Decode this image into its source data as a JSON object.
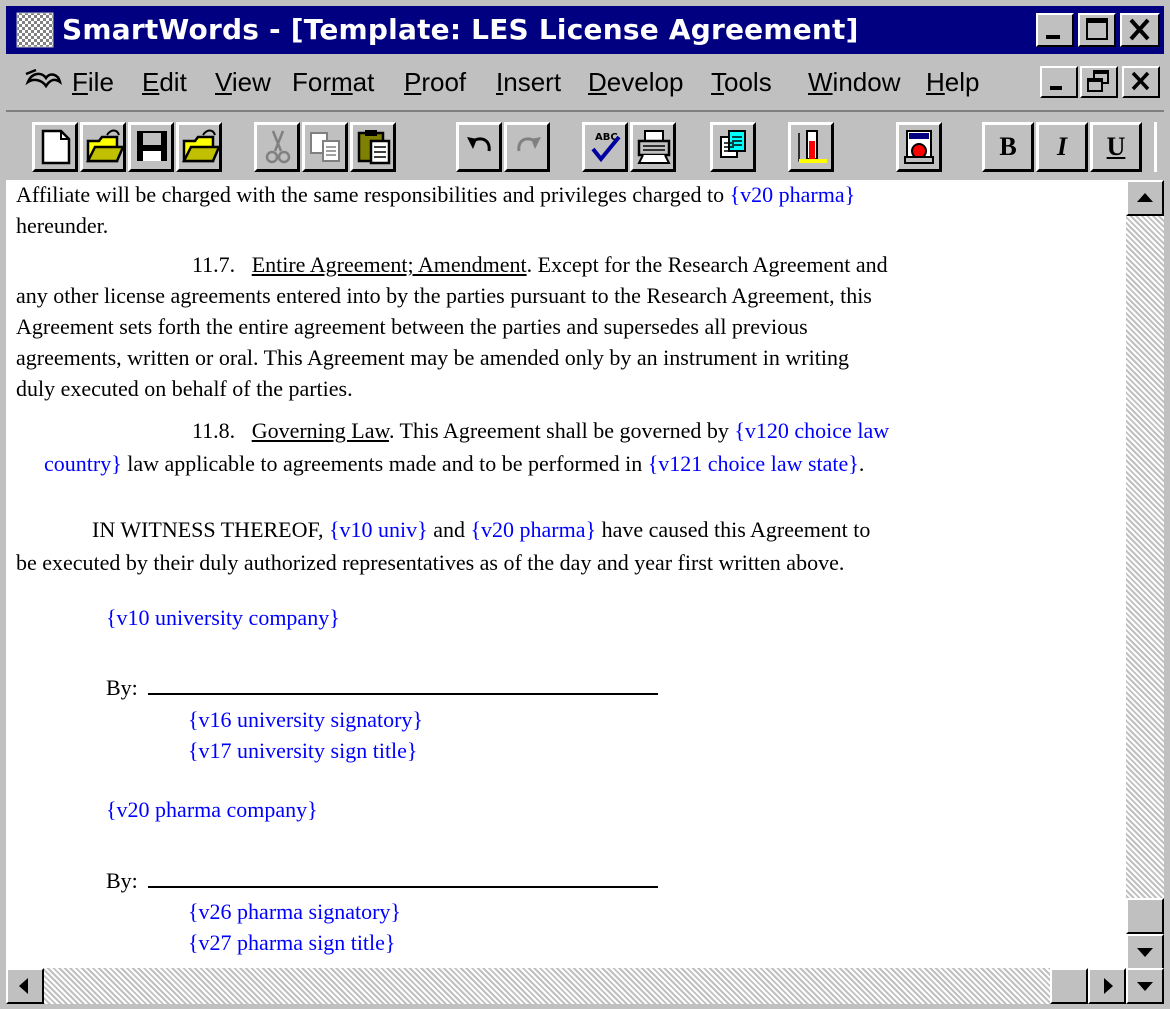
{
  "window": {
    "title": "SmartWords - [Template: LES License Agreement]"
  },
  "menu": {
    "items": [
      {
        "label": "File",
        "accel": "F",
        "rest": "ile"
      },
      {
        "label": "Edit",
        "accel": "E",
        "rest": "dit"
      },
      {
        "label": "View",
        "accel": "V",
        "rest": "iew"
      },
      {
        "label": "Format",
        "pre": "For",
        "accel": "m",
        "rest": "at"
      },
      {
        "label": "Proof",
        "accel": "P",
        "rest": "roof"
      },
      {
        "label": "Insert",
        "accel": "I",
        "rest": "nsert"
      },
      {
        "label": "Develop",
        "accel": "D",
        "rest": "evelop"
      },
      {
        "label": "Tools",
        "accel": "T",
        "rest": "ools"
      },
      {
        "label": "Window",
        "accel": "W",
        "rest": "indow"
      },
      {
        "label": "Help",
        "accel": "H",
        "rest": "elp"
      }
    ]
  },
  "toolbar": {
    "bold": "B",
    "italic": "I",
    "underline": "U"
  },
  "document": {
    "l1a": "Affiliate will be charged with the same responsibilities and privileges charged to ",
    "l1v": "{v20 pharma}",
    "l2": "hereunder.",
    "s117_num": "11.7.",
    "s117_title": "Entire Agreement; Amendment",
    "s117_l1": ". Except for the Research Agreement and",
    "s117_l2": "any other license agreements entered into by the parties pursuant to the Research Agreement, this",
    "s117_l3": "Agreement sets forth the entire agreement between the parties and supersedes all previous",
    "s117_l4": "agreements, written or oral. This Agreement may be amended only by an instrument in writing",
    "s117_l5": "duly executed on behalf of the parties.",
    "s118_num": "11.8.",
    "s118_title": "Governing Law",
    "s118_l1": ". This Agreement shall be governed by ",
    "s118_v1": "{v120 choice law",
    "s118_v1b": "country}",
    "s118_l2": " law applicable to agreements made and to be performed in ",
    "s118_v2": "{v121 choice law state}",
    "s118_end": ".",
    "wit_a": "IN WITNESS THEREOF, ",
    "wit_v1": "{v10 univ}",
    "wit_b": " and ",
    "wit_v2": "{v20 pharma}",
    "wit_c": " have caused this Agreement to",
    "wit_l2": "be executed by their duly authorized representatives as of the day and year first written above.",
    "univ_company": "{v10 university company}",
    "by1": "By:",
    "univ_signatory": "{v16 university signatory}",
    "univ_title": "{v17 university sign title}",
    "pharma_company": "{v20 pharma company}",
    "by2": "By:",
    "pharma_signatory": "{v26 pharma signatory}",
    "pharma_title": "{v27 pharma sign title}"
  },
  "colors": {
    "titlebar": "#000080",
    "variable_text": "#0000ff",
    "chrome": "#c0c0c0"
  }
}
